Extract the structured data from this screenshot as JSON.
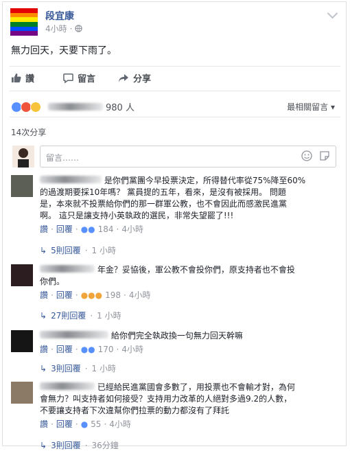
{
  "post": {
    "page_name": "段宜康",
    "time": "4小時",
    "privacy_icon": "globe-icon",
    "text": "無力回天，天要下雨了。"
  },
  "actions": {
    "like": "讚",
    "comment": "留言",
    "share": "分享"
  },
  "reactions": {
    "count": "980 人",
    "types": [
      "like",
      "angry",
      "wow"
    ]
  },
  "sort_label": "最相關留言",
  "shares": "14次分享",
  "composer": {
    "placeholder": "留言……"
  },
  "comments": [
    {
      "line1": "是你們黨團今早投票決定，所得替代率從75%降至60%",
      "line2": "的過渡期要採10年嗎？ 黨員提的五年，看來，是沒有被採用。 問題",
      "line3": "是，本來就不投票給你們的那一群軍公教，也不會因此而感激民進黨",
      "line4": "啊。 這只是讓支持小英執政的選民，非常失望罷了!!!",
      "like": "讚",
      "reply": "回覆",
      "reacts": "184",
      "time": "4小時",
      "replies": "5則回覆",
      "reply_time": "1 小時"
    },
    {
      "line1": "年金？妥協後，軍公教不會投你們，原支持者也不會投",
      "line2": "你們。",
      "like": "讚",
      "reply": "回覆",
      "reacts": "198",
      "time": "4小時",
      "replies": "27則回覆",
      "reply_time": "1 小時"
    },
    {
      "line1": "給你們完全執政換一句無力回天幹嘛",
      "like": "讚",
      "reply": "回覆",
      "reacts": "170",
      "time": "4小時",
      "replies": "3則回覆",
      "reply_time": "1 小時"
    },
    {
      "line1": "已經給民進黨國會多數了，用投票也不會輸才對，為何",
      "line2": "會無力？叫支持者如何接受？支持用力改革的人絕對多過9.2的人數，",
      "line3": "不要讓支持者下次違幫你們拉票的動力都沒有了拜託",
      "like": "讚",
      "reply": "回覆",
      "reacts": "55",
      "time": "4小時",
      "replies": "3則回覆",
      "reply_time": "36分鐘"
    }
  ]
}
